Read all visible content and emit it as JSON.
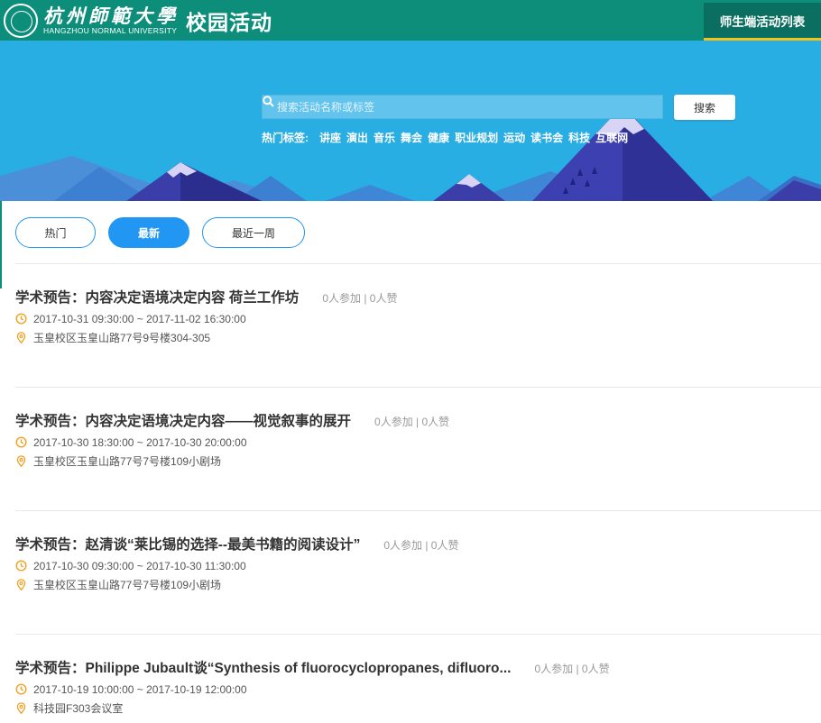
{
  "header": {
    "university_name": "杭州師範大學",
    "university_en": "HANGZHOU NORMAL UNIVERSITY",
    "app_title": "校园活动",
    "nav_button": "师生端活动列表",
    "colors": {
      "header_bg": "#0d8e7a",
      "accent_underline": "#f3c21b"
    }
  },
  "banner": {
    "search_placeholder": "搜索活动名称或标签",
    "search_button": "搜索",
    "hot_tags_label": "热门标签:",
    "hot_tags": [
      "讲座",
      "演出",
      "音乐",
      "舞会",
      "健康",
      "职业规划",
      "运动",
      "读书会",
      "科技",
      "互联网"
    ]
  },
  "filters": [
    {
      "label": "热门",
      "active": false
    },
    {
      "label": "最新",
      "active": true
    },
    {
      "label": "最近一周",
      "active": false
    }
  ],
  "activities": [
    {
      "title": "学术预告：内容决定语境决定内容 荷兰工作坊",
      "stats": "0人参加 | 0人赞",
      "time": "2017-10-31 09:30:00 ~ 2017-11-02 16:30:00",
      "location": "玉皇校区玉皇山路77号9号楼304-305"
    },
    {
      "title": "学术预告：内容决定语境决定内容——视觉叙事的展开",
      "stats": "0人参加 | 0人赞",
      "time": "2017-10-30 18:30:00 ~ 2017-10-30 20:00:00",
      "location": "玉皇校区玉皇山路77号7号楼109小剧场"
    },
    {
      "title": "学术预告：赵清谈“莱比锡的选择--最美书籍的阅读设计”",
      "stats": "0人参加 | 0人赞",
      "time": "2017-10-30 09:30:00 ~ 2017-10-30 11:30:00",
      "location": "玉皇校区玉皇山路77号7号楼109小剧场"
    },
    {
      "title": "学术预告：Philippe Jubault谈“Synthesis of fluorocyclopropanes, difluoro...",
      "stats": "0人参加 | 0人赞",
      "time": "2017-10-19 10:00:00 ~ 2017-10-19 12:00:00",
      "location": "科技园F303会议室"
    }
  ],
  "icons": {
    "time": "clock-icon",
    "location": "location-pin-icon",
    "search": "search-icon"
  },
  "colors": {
    "primary_blue": "#2196f3",
    "icon_orange": "#f0a020",
    "banner_sky": "#29aee3"
  }
}
